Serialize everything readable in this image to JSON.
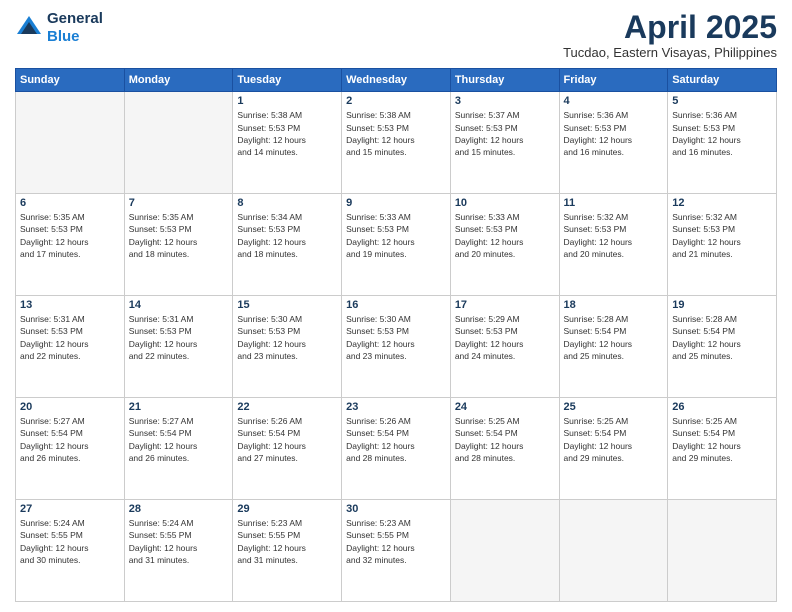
{
  "header": {
    "logo_line1": "General",
    "logo_line2": "Blue",
    "month": "April 2025",
    "location": "Tucdao, Eastern Visayas, Philippines"
  },
  "weekdays": [
    "Sunday",
    "Monday",
    "Tuesday",
    "Wednesday",
    "Thursday",
    "Friday",
    "Saturday"
  ],
  "weeks": [
    [
      {
        "day": "",
        "empty": true
      },
      {
        "day": "",
        "empty": true
      },
      {
        "day": "1",
        "lines": [
          "Sunrise: 5:38 AM",
          "Sunset: 5:53 PM",
          "Daylight: 12 hours",
          "and 14 minutes."
        ]
      },
      {
        "day": "2",
        "lines": [
          "Sunrise: 5:38 AM",
          "Sunset: 5:53 PM",
          "Daylight: 12 hours",
          "and 15 minutes."
        ]
      },
      {
        "day": "3",
        "lines": [
          "Sunrise: 5:37 AM",
          "Sunset: 5:53 PM",
          "Daylight: 12 hours",
          "and 15 minutes."
        ]
      },
      {
        "day": "4",
        "lines": [
          "Sunrise: 5:36 AM",
          "Sunset: 5:53 PM",
          "Daylight: 12 hours",
          "and 16 minutes."
        ]
      },
      {
        "day": "5",
        "lines": [
          "Sunrise: 5:36 AM",
          "Sunset: 5:53 PM",
          "Daylight: 12 hours",
          "and 16 minutes."
        ]
      }
    ],
    [
      {
        "day": "6",
        "lines": [
          "Sunrise: 5:35 AM",
          "Sunset: 5:53 PM",
          "Daylight: 12 hours",
          "and 17 minutes."
        ]
      },
      {
        "day": "7",
        "lines": [
          "Sunrise: 5:35 AM",
          "Sunset: 5:53 PM",
          "Daylight: 12 hours",
          "and 18 minutes."
        ]
      },
      {
        "day": "8",
        "lines": [
          "Sunrise: 5:34 AM",
          "Sunset: 5:53 PM",
          "Daylight: 12 hours",
          "and 18 minutes."
        ]
      },
      {
        "day": "9",
        "lines": [
          "Sunrise: 5:33 AM",
          "Sunset: 5:53 PM",
          "Daylight: 12 hours",
          "and 19 minutes."
        ]
      },
      {
        "day": "10",
        "lines": [
          "Sunrise: 5:33 AM",
          "Sunset: 5:53 PM",
          "Daylight: 12 hours",
          "and 20 minutes."
        ]
      },
      {
        "day": "11",
        "lines": [
          "Sunrise: 5:32 AM",
          "Sunset: 5:53 PM",
          "Daylight: 12 hours",
          "and 20 minutes."
        ]
      },
      {
        "day": "12",
        "lines": [
          "Sunrise: 5:32 AM",
          "Sunset: 5:53 PM",
          "Daylight: 12 hours",
          "and 21 minutes."
        ]
      }
    ],
    [
      {
        "day": "13",
        "lines": [
          "Sunrise: 5:31 AM",
          "Sunset: 5:53 PM",
          "Daylight: 12 hours",
          "and 22 minutes."
        ]
      },
      {
        "day": "14",
        "lines": [
          "Sunrise: 5:31 AM",
          "Sunset: 5:53 PM",
          "Daylight: 12 hours",
          "and 22 minutes."
        ]
      },
      {
        "day": "15",
        "lines": [
          "Sunrise: 5:30 AM",
          "Sunset: 5:53 PM",
          "Daylight: 12 hours",
          "and 23 minutes."
        ]
      },
      {
        "day": "16",
        "lines": [
          "Sunrise: 5:30 AM",
          "Sunset: 5:53 PM",
          "Daylight: 12 hours",
          "and 23 minutes."
        ]
      },
      {
        "day": "17",
        "lines": [
          "Sunrise: 5:29 AM",
          "Sunset: 5:53 PM",
          "Daylight: 12 hours",
          "and 24 minutes."
        ]
      },
      {
        "day": "18",
        "lines": [
          "Sunrise: 5:28 AM",
          "Sunset: 5:54 PM",
          "Daylight: 12 hours",
          "and 25 minutes."
        ]
      },
      {
        "day": "19",
        "lines": [
          "Sunrise: 5:28 AM",
          "Sunset: 5:54 PM",
          "Daylight: 12 hours",
          "and 25 minutes."
        ]
      }
    ],
    [
      {
        "day": "20",
        "lines": [
          "Sunrise: 5:27 AM",
          "Sunset: 5:54 PM",
          "Daylight: 12 hours",
          "and 26 minutes."
        ]
      },
      {
        "day": "21",
        "lines": [
          "Sunrise: 5:27 AM",
          "Sunset: 5:54 PM",
          "Daylight: 12 hours",
          "and 26 minutes."
        ]
      },
      {
        "day": "22",
        "lines": [
          "Sunrise: 5:26 AM",
          "Sunset: 5:54 PM",
          "Daylight: 12 hours",
          "and 27 minutes."
        ]
      },
      {
        "day": "23",
        "lines": [
          "Sunrise: 5:26 AM",
          "Sunset: 5:54 PM",
          "Daylight: 12 hours",
          "and 28 minutes."
        ]
      },
      {
        "day": "24",
        "lines": [
          "Sunrise: 5:25 AM",
          "Sunset: 5:54 PM",
          "Daylight: 12 hours",
          "and 28 minutes."
        ]
      },
      {
        "day": "25",
        "lines": [
          "Sunrise: 5:25 AM",
          "Sunset: 5:54 PM",
          "Daylight: 12 hours",
          "and 29 minutes."
        ]
      },
      {
        "day": "26",
        "lines": [
          "Sunrise: 5:25 AM",
          "Sunset: 5:54 PM",
          "Daylight: 12 hours",
          "and 29 minutes."
        ]
      }
    ],
    [
      {
        "day": "27",
        "lines": [
          "Sunrise: 5:24 AM",
          "Sunset: 5:55 PM",
          "Daylight: 12 hours",
          "and 30 minutes."
        ]
      },
      {
        "day": "28",
        "lines": [
          "Sunrise: 5:24 AM",
          "Sunset: 5:55 PM",
          "Daylight: 12 hours",
          "and 31 minutes."
        ]
      },
      {
        "day": "29",
        "lines": [
          "Sunrise: 5:23 AM",
          "Sunset: 5:55 PM",
          "Daylight: 12 hours",
          "and 31 minutes."
        ]
      },
      {
        "day": "30",
        "lines": [
          "Sunrise: 5:23 AM",
          "Sunset: 5:55 PM",
          "Daylight: 12 hours",
          "and 32 minutes."
        ]
      },
      {
        "day": "",
        "empty": true
      },
      {
        "day": "",
        "empty": true
      },
      {
        "day": "",
        "empty": true
      }
    ]
  ]
}
